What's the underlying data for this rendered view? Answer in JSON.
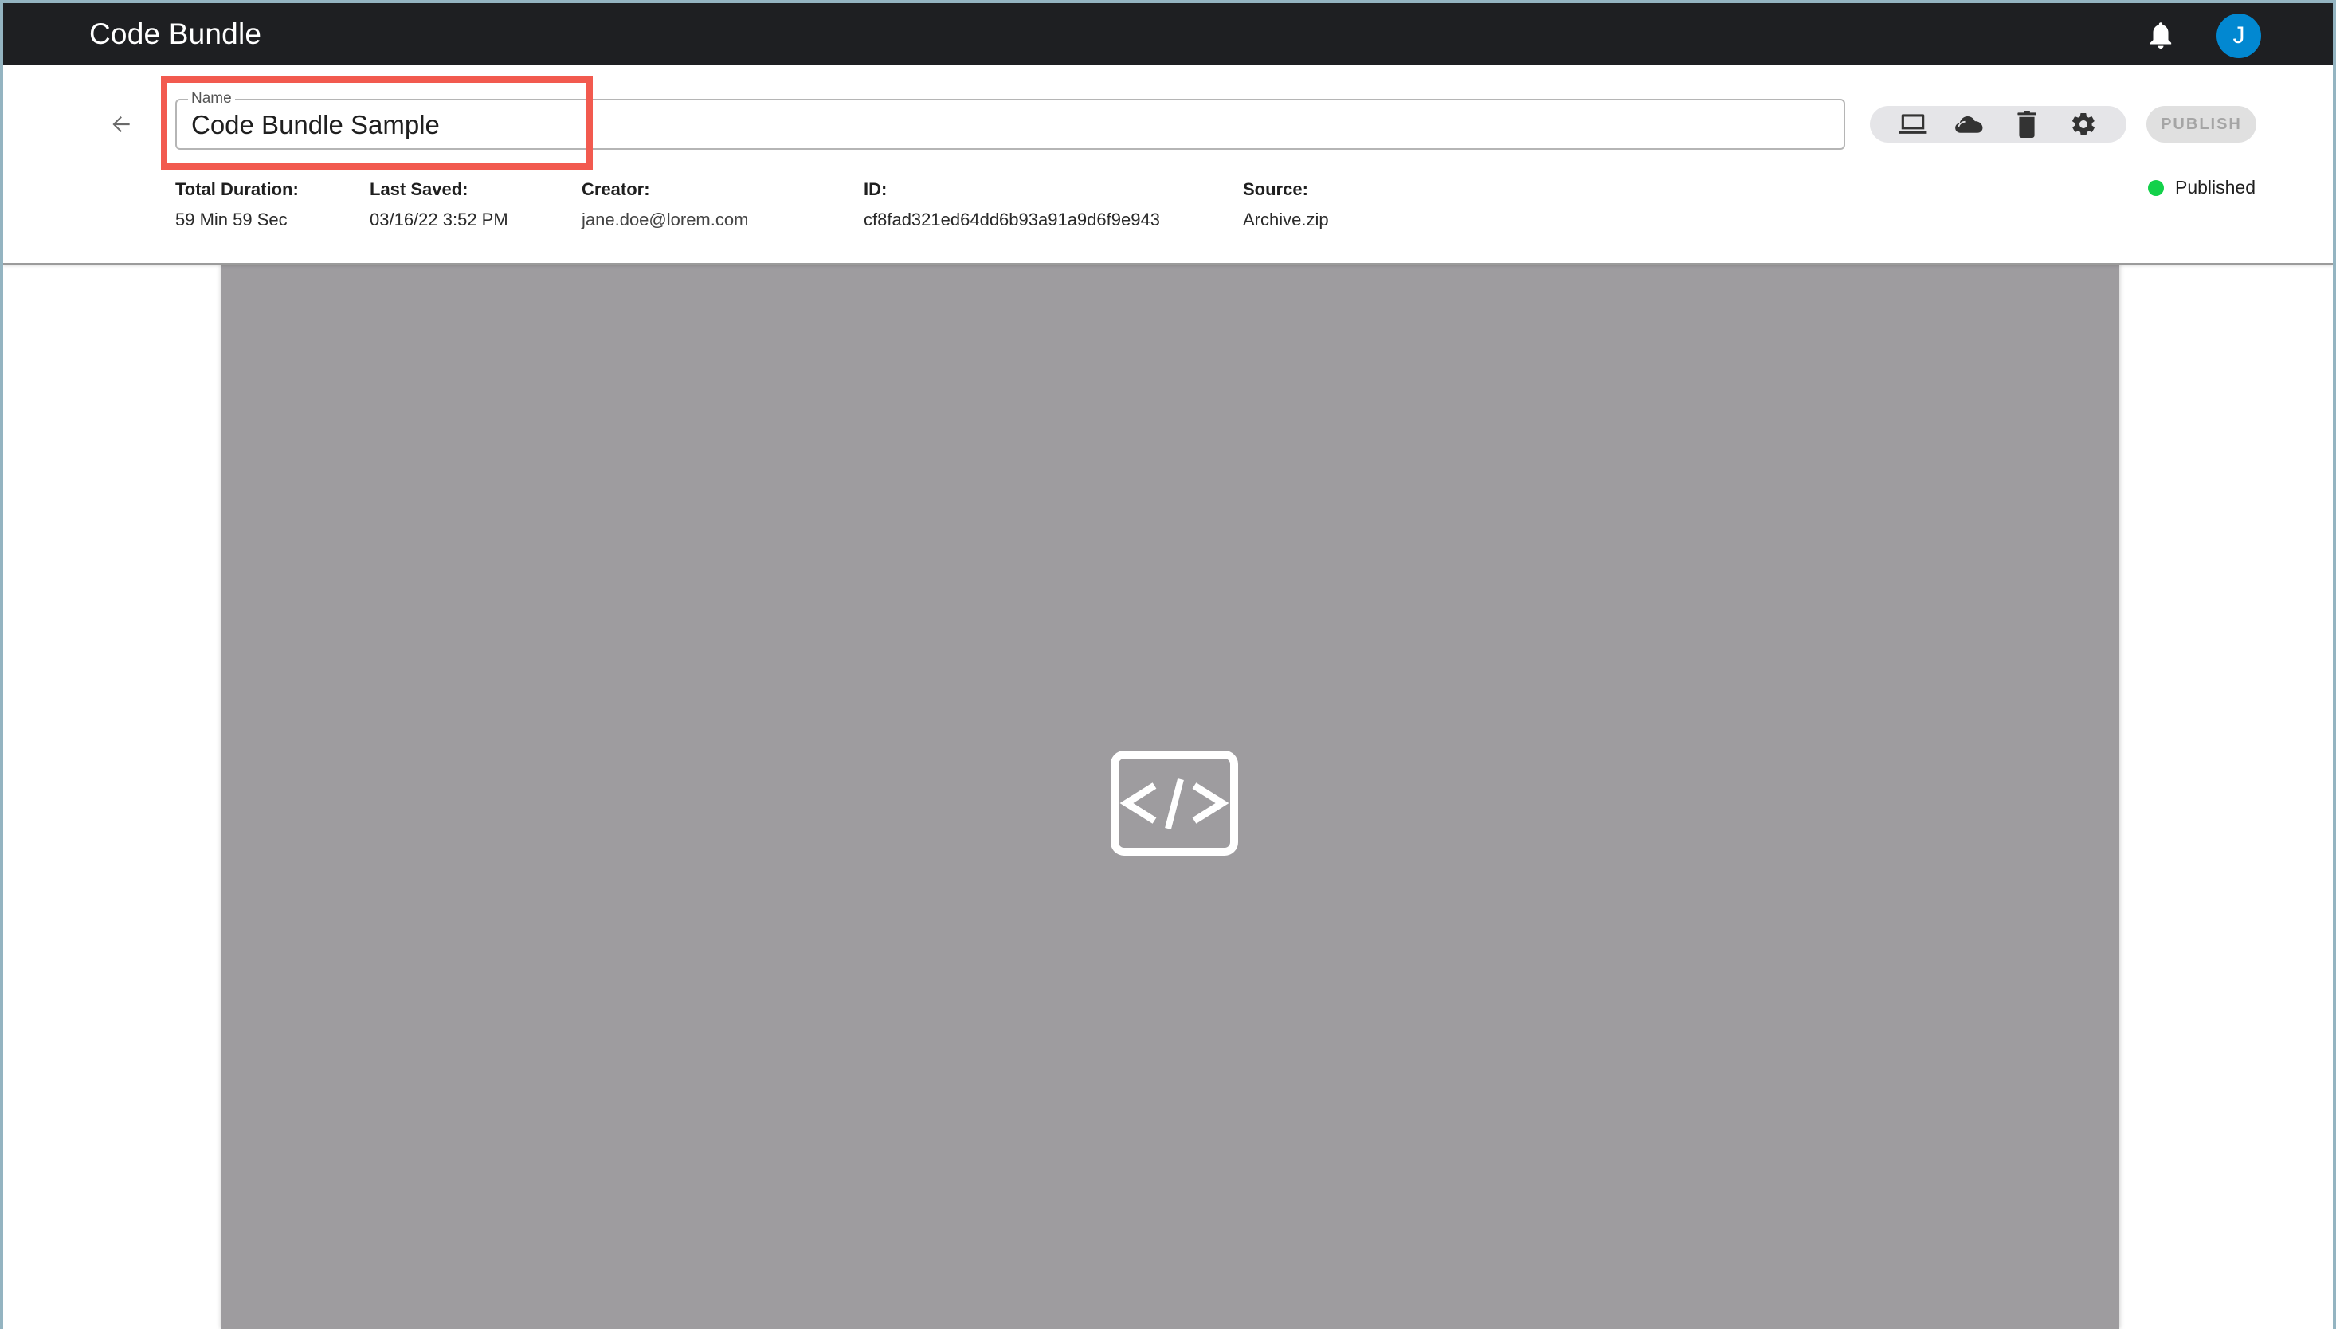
{
  "app": {
    "title": "Code Bundle"
  },
  "topbar": {
    "notifications_icon": "bell-icon",
    "avatar_initial": "J",
    "avatar_color": "#0288d1"
  },
  "header": {
    "back_icon": "arrow-left-icon",
    "name_field": {
      "label": "Name",
      "value": "Code Bundle Sample"
    },
    "actions": [
      {
        "name": "preview",
        "icon": "laptop-icon"
      },
      {
        "name": "cloud",
        "icon": "cloud-icon"
      },
      {
        "name": "delete",
        "icon": "trash-icon"
      },
      {
        "name": "settings",
        "icon": "gear-icon"
      }
    ],
    "publish_label": "PUBLISH",
    "status": {
      "label": "Published",
      "color": "#13d14a"
    },
    "meta": [
      {
        "label": "Total Duration:",
        "value": "59 Min 59 Sec"
      },
      {
        "label": "Last Saved:",
        "value": "03/16/22 3:52 PM"
      },
      {
        "label": "Creator:",
        "value": "jane.doe@lorem.com"
      },
      {
        "label": "ID:",
        "value": "cf8fad321ed64dd6b93a91a9d6f9e943"
      },
      {
        "label": "Source:",
        "value": "Archive.zip"
      }
    ]
  },
  "preview": {
    "placeholder_icon": "code-icon",
    "background": "#9e9c9f"
  },
  "highlight": {
    "target": "name-field",
    "color": "#f25a4f"
  }
}
